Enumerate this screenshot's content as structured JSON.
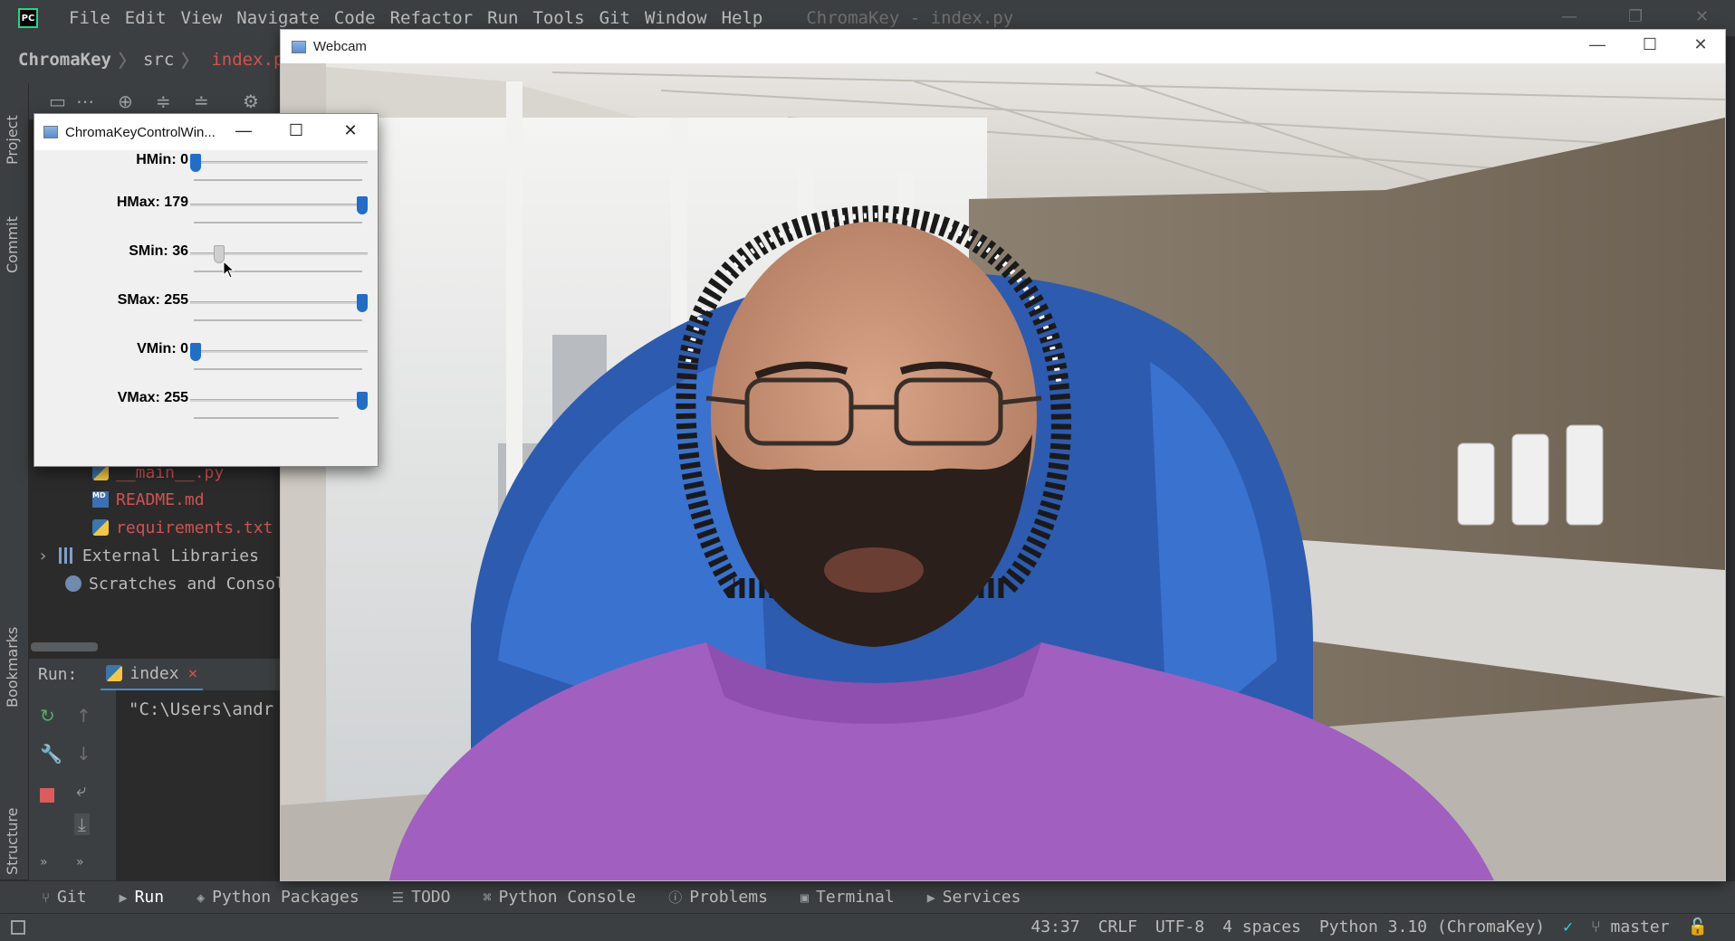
{
  "ide": {
    "logo": "PC",
    "menu": [
      "File",
      "Edit",
      "View",
      "Navigate",
      "Code",
      "Refactor",
      "Run",
      "Tools",
      "Git",
      "Window",
      "Help"
    ],
    "window_title": "ChromaKey - index.py",
    "breadcrumb": {
      "project": "ChromaKey",
      "folder": "src",
      "file": "index.py"
    },
    "side_tabs": {
      "project": "Project",
      "commit": "Commit",
      "bookmarks": "Bookmarks",
      "structure": "Structure"
    },
    "tree": [
      {
        "name": "__main__.py",
        "icon": "python-file-icon"
      },
      {
        "name": "README.md",
        "icon": "markdown-file-icon"
      },
      {
        "name": "requirements.txt",
        "icon": "text-file-icon"
      },
      {
        "name": "External Libraries",
        "icon": "library-icon"
      },
      {
        "name": "Scratches and Consoles",
        "icon": "scratch-icon"
      }
    ],
    "run_panel": {
      "label": "Run:",
      "tab": "index",
      "output": "\"C:\\Users\\andr"
    },
    "bottom_tabs": [
      "Git",
      "Run",
      "Python Packages",
      "TODO",
      "Python Console",
      "Problems",
      "Terminal",
      "Services"
    ],
    "status": {
      "position": "43:37",
      "line_sep": "CRLF",
      "encoding": "UTF-8",
      "indent": "4 spaces",
      "interpreter": "Python 3.10 (ChromaKey)",
      "branch": "master"
    }
  },
  "webcam": {
    "title": "Webcam"
  },
  "control": {
    "title": "ChromaKeyControlWin...",
    "trackbars": [
      {
        "label": "HMin: 0",
        "value": 0,
        "max": 179
      },
      {
        "label": "HMax: 179",
        "value": 179,
        "max": 179
      },
      {
        "label": "SMin: 36",
        "value": 36,
        "max": 255
      },
      {
        "label": "SMax: 255",
        "value": 255,
        "max": 255
      },
      {
        "label": "VMin: 0",
        "value": 0,
        "max": 255
      },
      {
        "label": "VMax: 255",
        "value": 255,
        "max": 255
      }
    ]
  },
  "colors": {
    "accent": "#1f6ec9",
    "ide_bg": "#2b2b2b",
    "shirt": "#a15fc0",
    "chair": "#2d5bb0"
  }
}
